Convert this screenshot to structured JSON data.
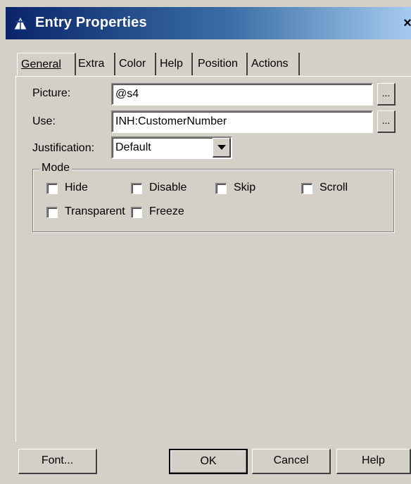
{
  "window": {
    "title": "Entry Properties",
    "close_glyph": "×",
    "icon": "app-icon"
  },
  "tabs": [
    {
      "label": "General",
      "active": true
    },
    {
      "label": "Extra",
      "active": false
    },
    {
      "label": "Color",
      "active": false
    },
    {
      "label": "Help",
      "active": false
    },
    {
      "label": "Position",
      "active": false
    },
    {
      "label": "Actions",
      "active": false
    }
  ],
  "form": {
    "picture_label": "Picture:",
    "picture_value": "@s4",
    "use_label": "Use:",
    "use_value": "INH:CustomerNumber",
    "justification_label": "Justification:",
    "justification_value": "Default",
    "ellipsis": "..."
  },
  "mode": {
    "label": "Mode",
    "options": [
      {
        "label": "Hide",
        "checked": false
      },
      {
        "label": "Disable",
        "checked": false
      },
      {
        "label": "Skip",
        "checked": false
      },
      {
        "label": "Scroll",
        "checked": false
      },
      {
        "label": "Transparent",
        "checked": false
      },
      {
        "label": "Freeze",
        "checked": false
      }
    ]
  },
  "buttons": {
    "font": "Font...",
    "ok": "OK",
    "cancel": "Cancel",
    "help": "Help"
  },
  "colors": {
    "titlebar_start": "#0a246a",
    "titlebar_end": "#a6caf0",
    "face": "#d4d0c8"
  }
}
